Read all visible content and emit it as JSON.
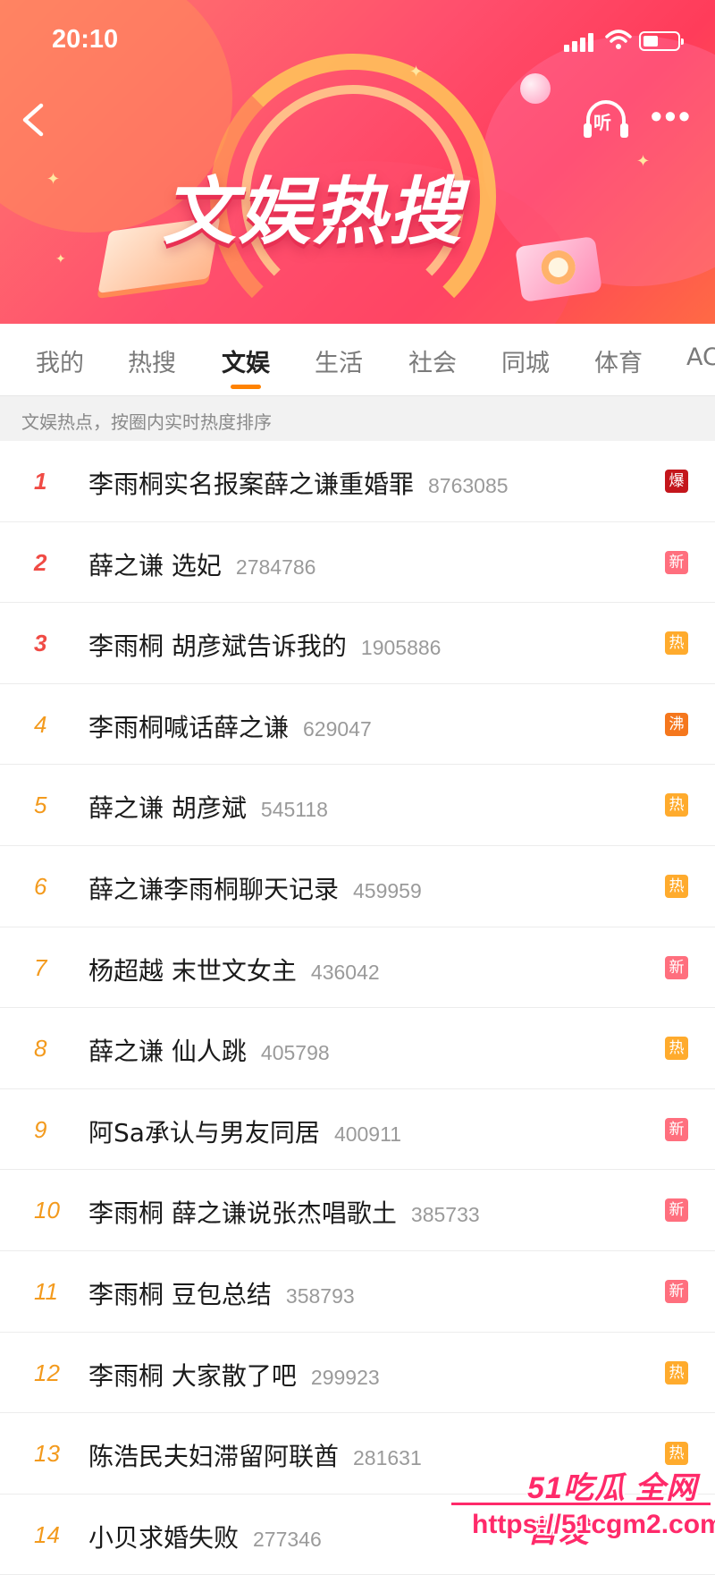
{
  "status_bar": {
    "time": "20:10"
  },
  "banner": {
    "title": "文娱热搜",
    "listen_label": "听",
    "more_label": "•••"
  },
  "tabs": [
    {
      "label": "我的"
    },
    {
      "label": "热搜"
    },
    {
      "label": "文娱",
      "active": true
    },
    {
      "label": "生活"
    },
    {
      "label": "社会"
    },
    {
      "label": "同城"
    },
    {
      "label": "体育"
    },
    {
      "label": "AC"
    }
  ],
  "subtitle": "文娱热点，按圈内实时热度排序",
  "hot_list": [
    {
      "rank": "1",
      "topic": "李雨桐实名报案薛之谦重婚罪",
      "count": "8763085",
      "badge": "爆",
      "badge_color": "#c4161c"
    },
    {
      "rank": "2",
      "topic": "薛之谦 选妃",
      "count": "2784786",
      "badge": "新",
      "badge_color": "#ff6f7e"
    },
    {
      "rank": "3",
      "topic": "李雨桐 胡彦斌告诉我的",
      "count": "1905886",
      "badge": "热",
      "badge_color": "#ffab2d"
    },
    {
      "rank": "4",
      "topic": "李雨桐喊话薛之谦",
      "count": "629047",
      "badge": "沸",
      "badge_color": "#f5771d"
    },
    {
      "rank": "5",
      "topic": "薛之谦 胡彦斌",
      "count": "545118",
      "badge": "热",
      "badge_color": "#ffab2d"
    },
    {
      "rank": "6",
      "topic": "薛之谦李雨桐聊天记录",
      "count": "459959",
      "badge": "热",
      "badge_color": "#ffab2d"
    },
    {
      "rank": "7",
      "topic": "杨超越 末世文女主",
      "count": "436042",
      "badge": "新",
      "badge_color": "#ff6f7e"
    },
    {
      "rank": "8",
      "topic": "薛之谦 仙人跳",
      "count": "405798",
      "badge": "热",
      "badge_color": "#ffab2d"
    },
    {
      "rank": "9",
      "topic": "阿Sa承认与男友同居",
      "count": "400911",
      "badge": "新",
      "badge_color": "#ff6f7e"
    },
    {
      "rank": "10",
      "topic": "李雨桐 薛之谦说张杰唱歌土",
      "count": "385733",
      "badge": "新",
      "badge_color": "#ff6f7e"
    },
    {
      "rank": "11",
      "topic": "李雨桐 豆包总结",
      "count": "358793",
      "badge": "新",
      "badge_color": "#ff6f7e"
    },
    {
      "rank": "12",
      "topic": "李雨桐 大家散了吧",
      "count": "299923",
      "badge": "热",
      "badge_color": "#ffab2d"
    },
    {
      "rank": "13",
      "topic": "陈浩民夫妇滞留阿联酋",
      "count": "281631",
      "badge": "热",
      "badge_color": "#ffab2d"
    },
    {
      "rank": "14",
      "topic": "小贝求婚失败",
      "count": "277346",
      "badge": "",
      "badge_color": "#ff6f7e"
    }
  ],
  "watermark": {
    "brand": "51吃瓜 全网首发",
    "url": "https://51cgm2.com"
  }
}
